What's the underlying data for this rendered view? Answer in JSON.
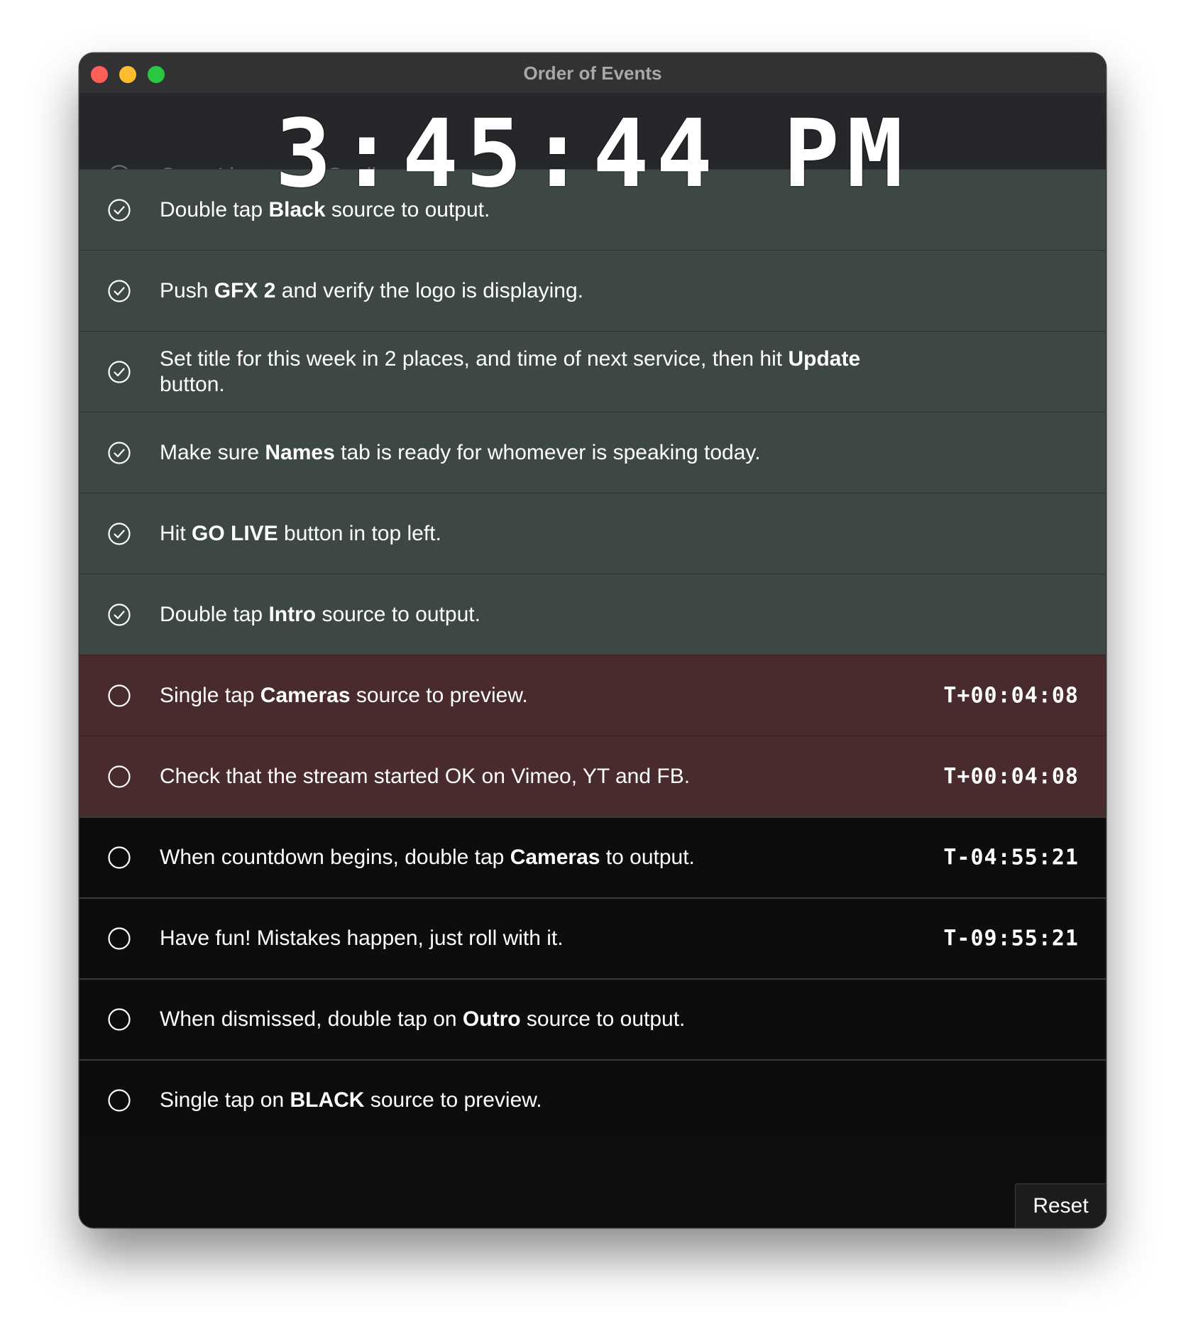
{
  "window": {
    "title": "Order of Events"
  },
  "clock": "3:45:44 PM",
  "items": [
    {
      "state": "faded",
      "checked": true,
      "segments": [
        {
          "text": "Open Livestream Studio.",
          "bold": false
        }
      ],
      "timer": ""
    },
    {
      "state": "done",
      "checked": true,
      "segments": [
        {
          "text": "Double tap ",
          "bold": false
        },
        {
          "text": "Black",
          "bold": true
        },
        {
          "text": " source to output.",
          "bold": false
        }
      ],
      "timer": ""
    },
    {
      "state": "done",
      "checked": true,
      "segments": [
        {
          "text": "Push ",
          "bold": false
        },
        {
          "text": "GFX 2",
          "bold": true
        },
        {
          "text": " and verify the logo is displaying.",
          "bold": false
        }
      ],
      "timer": ""
    },
    {
      "state": "done",
      "checked": true,
      "segments": [
        {
          "text": "Set title for this week in 2 places, and time of next service, then hit ",
          "bold": false
        },
        {
          "text": "Update",
          "bold": true
        },
        {
          "text": " button.",
          "bold": false
        }
      ],
      "timer": ""
    },
    {
      "state": "done",
      "checked": true,
      "segments": [
        {
          "text": "Make sure ",
          "bold": false
        },
        {
          "text": "Names",
          "bold": true
        },
        {
          "text": " tab is ready for whomever is speaking today.",
          "bold": false
        }
      ],
      "timer": ""
    },
    {
      "state": "done",
      "checked": true,
      "segments": [
        {
          "text": "Hit ",
          "bold": false
        },
        {
          "text": "GO LIVE",
          "bold": true
        },
        {
          "text": " button in top left.",
          "bold": false
        }
      ],
      "timer": ""
    },
    {
      "state": "done",
      "checked": true,
      "segments": [
        {
          "text": "Double tap ",
          "bold": false
        },
        {
          "text": "Intro",
          "bold": true
        },
        {
          "text": " source to output.",
          "bold": false
        }
      ],
      "timer": ""
    },
    {
      "state": "late",
      "checked": false,
      "segments": [
        {
          "text": "Single tap ",
          "bold": false
        },
        {
          "text": "Cameras",
          "bold": true
        },
        {
          "text": " source to preview.",
          "bold": false
        }
      ],
      "timer": "T+00:04:08"
    },
    {
      "state": "late",
      "checked": false,
      "segments": [
        {
          "text": "Check that the stream started OK on Vimeo, YT and FB.",
          "bold": false
        }
      ],
      "timer": "T+00:04:08"
    },
    {
      "state": "pending",
      "checked": false,
      "segments": [
        {
          "text": "When countdown begins, double tap ",
          "bold": false
        },
        {
          "text": "Cameras",
          "bold": true
        },
        {
          "text": " to output.",
          "bold": false
        }
      ],
      "timer": "T-04:55:21"
    },
    {
      "state": "pending",
      "checked": false,
      "segments": [
        {
          "text": "Have fun! Mistakes happen, just roll with it.",
          "bold": false
        }
      ],
      "timer": "T-09:55:21"
    },
    {
      "state": "pending",
      "checked": false,
      "segments": [
        {
          "text": "When dismissed, double tap on ",
          "bold": false
        },
        {
          "text": "Outro",
          "bold": true
        },
        {
          "text": " source to output.",
          "bold": false
        }
      ],
      "timer": ""
    },
    {
      "state": "pending",
      "checked": false,
      "segments": [
        {
          "text": "Single tap on ",
          "bold": false
        },
        {
          "text": "BLACK",
          "bold": true
        },
        {
          "text": " source to preview.",
          "bold": false
        }
      ],
      "timer": ""
    }
  ],
  "reset_label": "Reset"
}
